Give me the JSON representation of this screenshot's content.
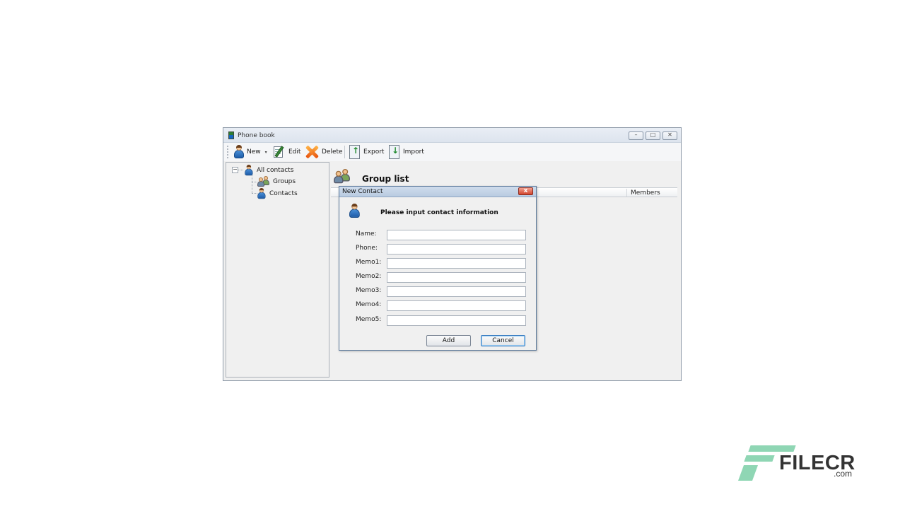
{
  "window": {
    "title": "Phone book",
    "minimize_glyph": "–",
    "maximize_glyph": "□",
    "close_glyph": "✕"
  },
  "toolbar": {
    "new_label": "New",
    "edit_label": "Edit",
    "delete_label": "Delete",
    "export_label": "Export",
    "import_label": "Import",
    "new_dropdown_glyph": "▾"
  },
  "tree": {
    "expander_glyph": "−",
    "root_label": "All contacts",
    "items": [
      {
        "label": "Groups",
        "icon": "group-icon"
      },
      {
        "label": "Contacts",
        "icon": "person-icon"
      }
    ]
  },
  "group_list": {
    "title": "Group list",
    "columns": [
      "Members"
    ]
  },
  "dialog": {
    "title": "New Contact",
    "close_glyph": "x",
    "heading": "Please input contact information",
    "fields": [
      {
        "label": "Name:",
        "value": ""
      },
      {
        "label": "Phone:",
        "value": ""
      },
      {
        "label": "Memo1:",
        "value": ""
      },
      {
        "label": "Memo2:",
        "value": ""
      },
      {
        "label": "Memo3:",
        "value": ""
      },
      {
        "label": "Memo4:",
        "value": ""
      },
      {
        "label": "Memo5:",
        "value": ""
      }
    ],
    "add_label": "Add",
    "cancel_label": "Cancel"
  },
  "watermark": {
    "brand": "FILECR",
    "tld": ".com",
    "accent_color": "#8fd6b4"
  }
}
